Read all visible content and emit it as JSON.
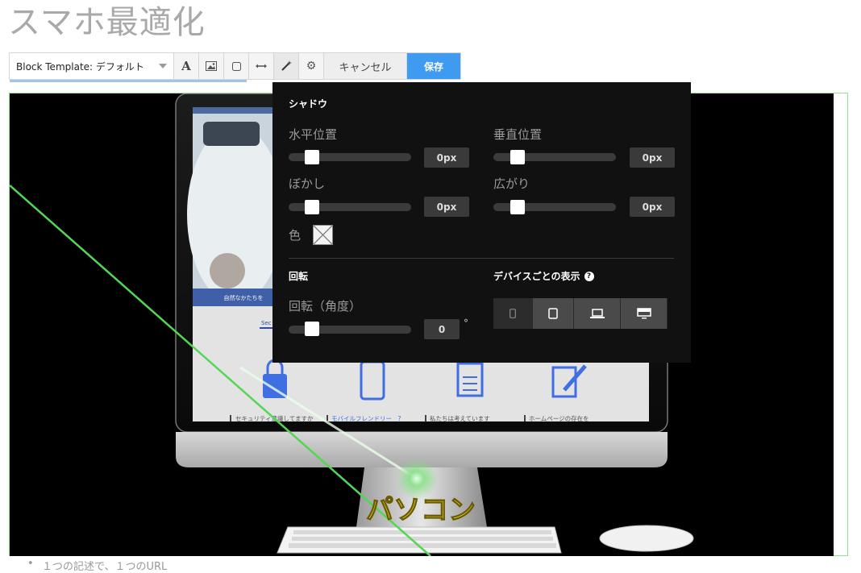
{
  "page": {
    "title": "スマホ最適化"
  },
  "toolbar": {
    "template_label": "Block Template:",
    "template_value": "デフォルト",
    "cancel_label": "キャンセル",
    "save_label": "保存"
  },
  "shadow": {
    "title": "シャドウ",
    "horizontal_label": "水平位置",
    "horizontal_value": "0px",
    "vertical_label": "垂直位置",
    "vertical_value": "0px",
    "blur_label": "ぼかし",
    "blur_value": "0px",
    "spread_label": "広がり",
    "spread_value": "0px",
    "color_label": "色"
  },
  "rotation": {
    "title": "回転",
    "angle_label": "回転（角度）",
    "angle_value": "0",
    "unit": "°"
  },
  "device": {
    "title": "デバイスごとの表示",
    "icons": [
      "phone-small-icon",
      "tablet-icon",
      "laptop-icon",
      "desktop-icon"
    ]
  },
  "screen": {
    "caption_1": "セキュリティ意識してますか",
    "caption_2": "モバイルフレンドリー　?",
    "caption_3": "私たちは考えています",
    "caption_4": "ホームページの存在を",
    "banner_text": "自然なかたちを",
    "monitor_label": "パソコン"
  },
  "list": {
    "item_1": "１つの記述で、１つのURL"
  },
  "colors": {
    "accent": "#3f9bf0",
    "panel_bg": "#111111",
    "frame": "#8fe08f"
  }
}
